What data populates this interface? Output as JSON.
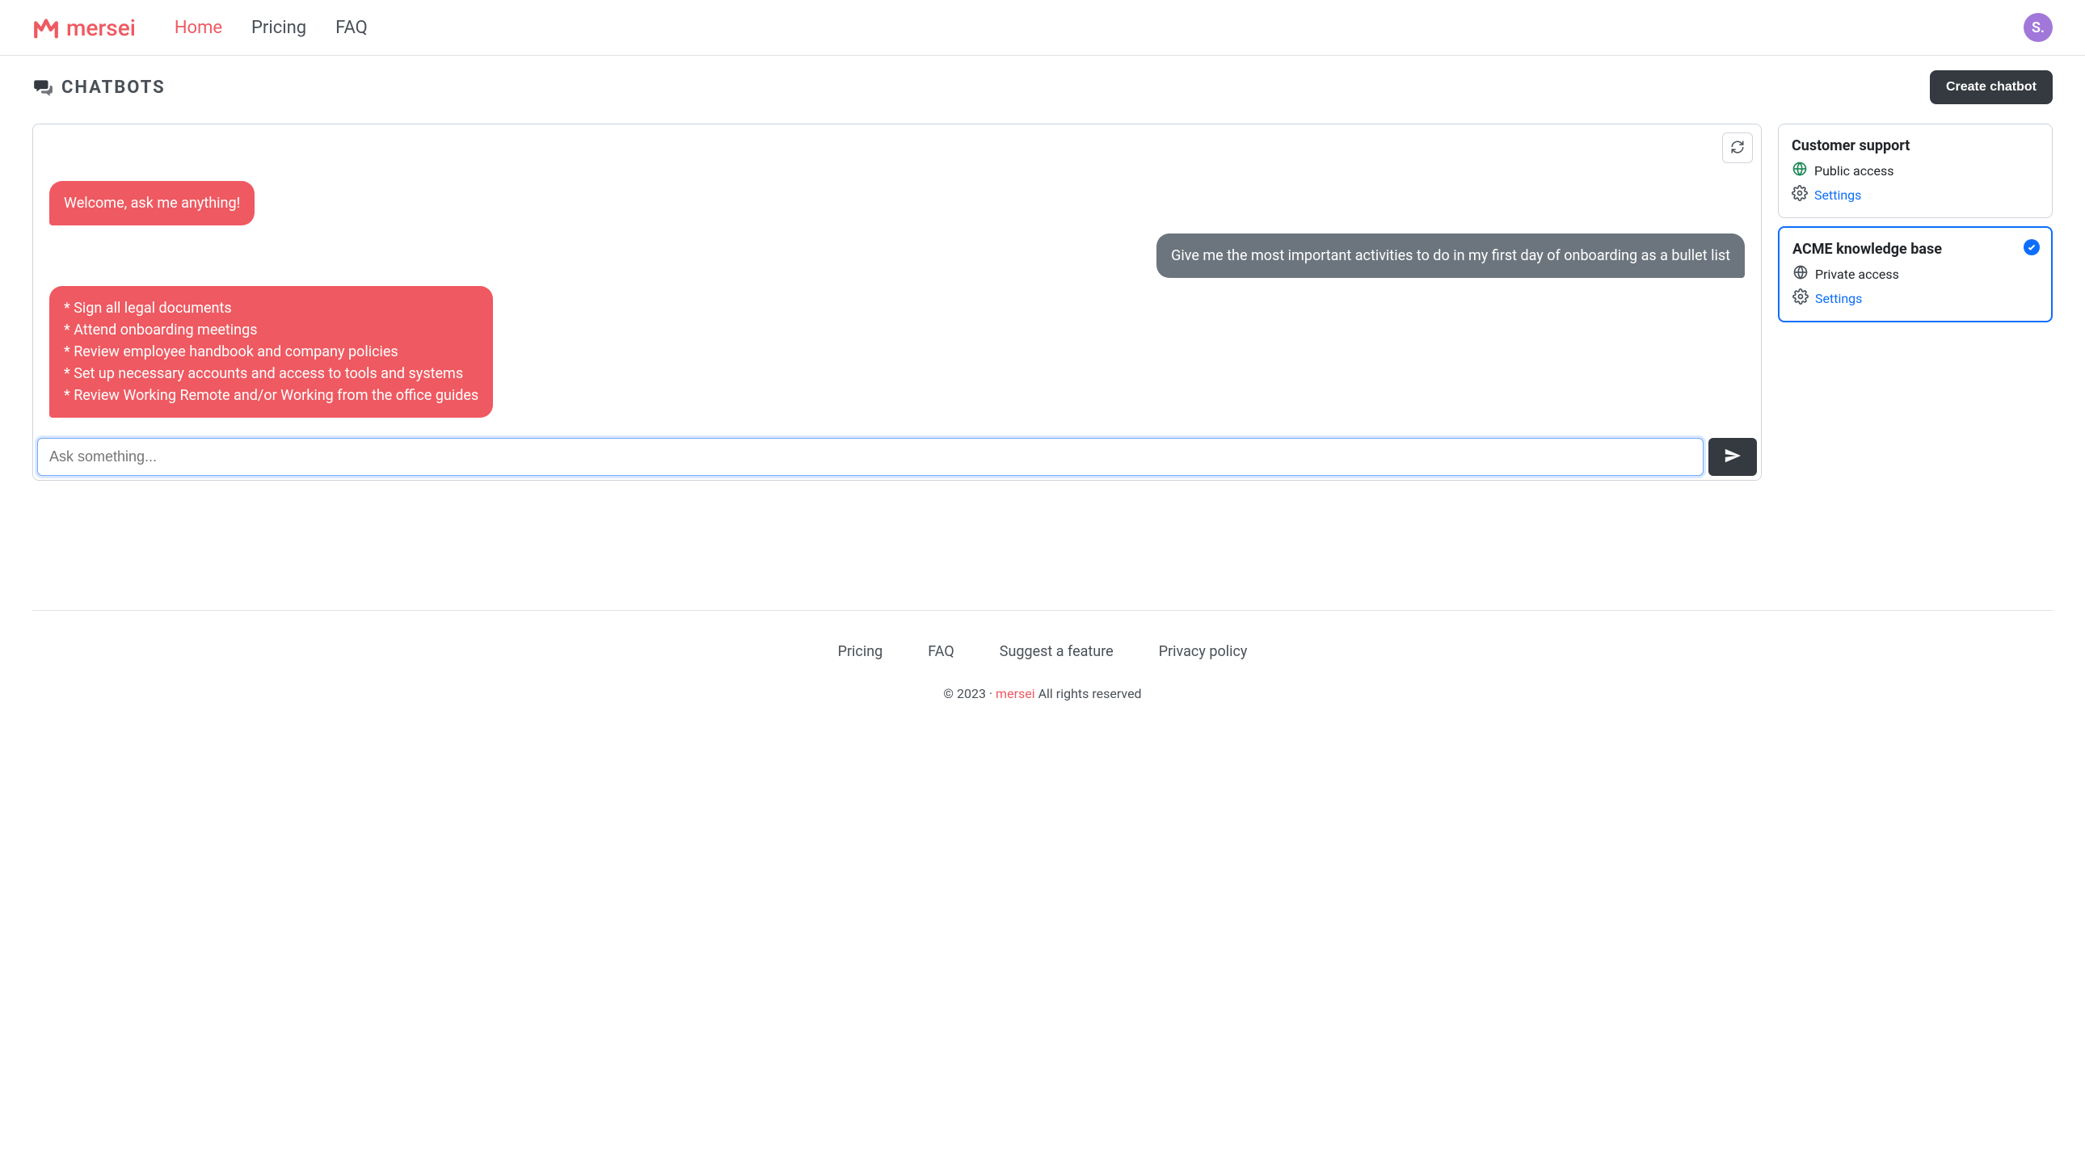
{
  "brand": "mersei",
  "nav": {
    "home": "Home",
    "pricing": "Pricing",
    "faq": "FAQ"
  },
  "avatar_initials": "S.",
  "page_title": "CHATBOTS",
  "create_button": "Create chatbot",
  "messages": {
    "welcome": "Welcome, ask me anything!",
    "user_q": "Give me the most important activities to do in my first day of onboarding as a bullet list",
    "bot_answer": "* Sign all legal documents\n* Attend onboarding meetings\n* Review employee handbook and company policies\n* Set up necessary accounts and access to tools and systems\n* Review Working Remote and/or Working from the office guides"
  },
  "chat_input_placeholder": "Ask something...",
  "chatbots": [
    {
      "title": "Customer support",
      "access_label": "Public access",
      "settings_label": "Settings",
      "selected": false
    },
    {
      "title": "ACME knowledge base",
      "access_label": "Private access",
      "settings_label": "Settings",
      "selected": true
    }
  ],
  "footer": {
    "pricing": "Pricing",
    "faq": "FAQ",
    "suggest": "Suggest a feature",
    "privacy": "Privacy policy",
    "copyright_prefix": "© 2023 · ",
    "brand_link": "mersei",
    "copyright_suffix": " All rights reserved"
  }
}
